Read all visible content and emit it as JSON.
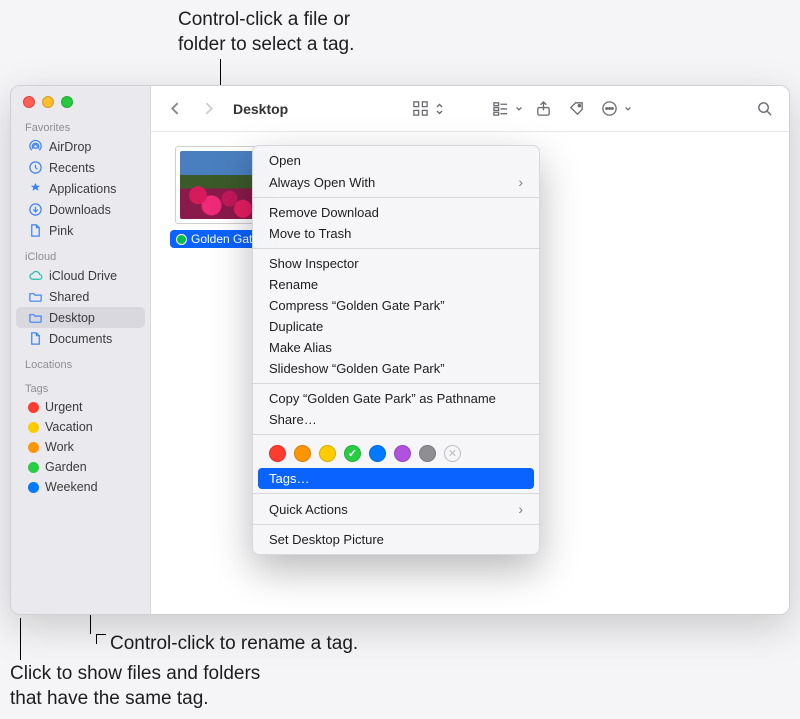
{
  "annotations": {
    "top": "Control-click a file or\nfolder to select a tag.",
    "middle": "Control-click to rename a tag.",
    "bottom": "Click to show files and folders\nthat have the same tag."
  },
  "toolbar": {
    "title": "Desktop"
  },
  "sidebar": {
    "sections": {
      "favorites": "Favorites",
      "icloud": "iCloud",
      "locations": "Locations",
      "tags": "Tags"
    },
    "favorites": [
      {
        "label": "AirDrop",
        "icon": "airdrop"
      },
      {
        "label": "Recents",
        "icon": "clock"
      },
      {
        "label": "Applications",
        "icon": "apps"
      },
      {
        "label": "Downloads",
        "icon": "download"
      },
      {
        "label": "Pink",
        "icon": "doc"
      }
    ],
    "icloud": [
      {
        "label": "iCloud Drive",
        "icon": "cloud"
      },
      {
        "label": "Shared",
        "icon": "folder"
      },
      {
        "label": "Desktop",
        "icon": "folder",
        "selected": true
      },
      {
        "label": "Documents",
        "icon": "doc"
      }
    ],
    "tags": [
      {
        "label": "Urgent",
        "color": "#ff3b30"
      },
      {
        "label": "Vacation",
        "color": "#ffcc00"
      },
      {
        "label": "Work",
        "color": "#ff9500"
      },
      {
        "label": "Garden",
        "color": "#28cd41"
      },
      {
        "label": "Weekend",
        "color": "#007aff"
      }
    ]
  },
  "file": {
    "name": "Golden Gate Park"
  },
  "context_menu": {
    "open": "Open",
    "always_open_with": "Always Open With",
    "remove_download": "Remove Download",
    "move_to_trash": "Move to Trash",
    "show_inspector": "Show Inspector",
    "rename": "Rename",
    "compress": "Compress “Golden Gate Park”",
    "duplicate": "Duplicate",
    "make_alias": "Make Alias",
    "slideshow": "Slideshow “Golden Gate Park”",
    "copy_pathname": "Copy “Golden Gate Park” as Pathname",
    "share": "Share…",
    "tags": "Tags…",
    "quick_actions": "Quick Actions",
    "set_desktop_picture": "Set Desktop Picture",
    "tag_colors": [
      {
        "color": "#ff3b30",
        "checked": false
      },
      {
        "color": "#ff9500",
        "checked": false
      },
      {
        "color": "#ffcc00",
        "checked": false
      },
      {
        "color": "#28cd41",
        "checked": true
      },
      {
        "color": "#007aff",
        "checked": false
      },
      {
        "color": "#af52de",
        "checked": false
      },
      {
        "color": "#8e8e93",
        "checked": false
      }
    ]
  }
}
